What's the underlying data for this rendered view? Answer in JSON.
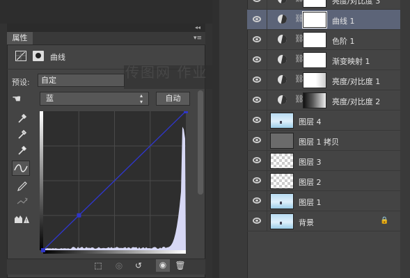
{
  "properties_panel": {
    "tab_label": "属性",
    "collapse_icon": "double-chevron",
    "menu_icon": "panel-menu",
    "adjustment_title": "曲线",
    "preset_label": "预设:",
    "preset_value": "自定",
    "channel_value": "蓝",
    "auto_button": "自动",
    "tools": [
      "hand-target-icon",
      "eyedropper-black-icon",
      "eyedropper-gray-icon",
      "eyedropper-white-icon",
      "curve-edit-icon",
      "pencil-icon",
      "smooth-icon",
      "clipping-warning-icon"
    ],
    "bottom_icons": [
      "clip-to-layer-icon",
      "view-previous-icon",
      "reset-icon",
      "visibility-eye-icon",
      "trash-icon"
    ]
  },
  "curve": {
    "channel_color": "#2f36c8",
    "histogram_color": "#d7d8f5",
    "points": [
      [
        0,
        0
      ],
      [
        64,
        64
      ],
      [
        255,
        255
      ]
    ]
  },
  "watermark_text": "传图网 作业 作",
  "layers": {
    "items": [
      {
        "name": "亮度/对比度 3",
        "type": "partial",
        "selected": false
      },
      {
        "name": "曲线 1",
        "type": "adjustment",
        "mask": "white",
        "selected": true
      },
      {
        "name": "色阶 1",
        "type": "adjustment",
        "mask": "white",
        "selected": false
      },
      {
        "name": "渐变映射 1",
        "type": "adjustment",
        "mask": "white",
        "selected": false
      },
      {
        "name": "亮度/对比度 1",
        "type": "adjustment",
        "mask": "light",
        "selected": false
      },
      {
        "name": "亮度/对比度 2",
        "type": "adjustment",
        "mask": "dark",
        "selected": false
      },
      {
        "name": "图层 4",
        "type": "image",
        "selected": false
      },
      {
        "name": "图层 1 拷贝",
        "type": "gray",
        "selected": false
      },
      {
        "name": "图层 3",
        "type": "transparent",
        "selected": false
      },
      {
        "name": "图层 2",
        "type": "transparent",
        "selected": false
      },
      {
        "name": "图层 1",
        "type": "image",
        "selected": false
      },
      {
        "name": "背景",
        "type": "image",
        "locked": true,
        "selected": false
      }
    ]
  }
}
